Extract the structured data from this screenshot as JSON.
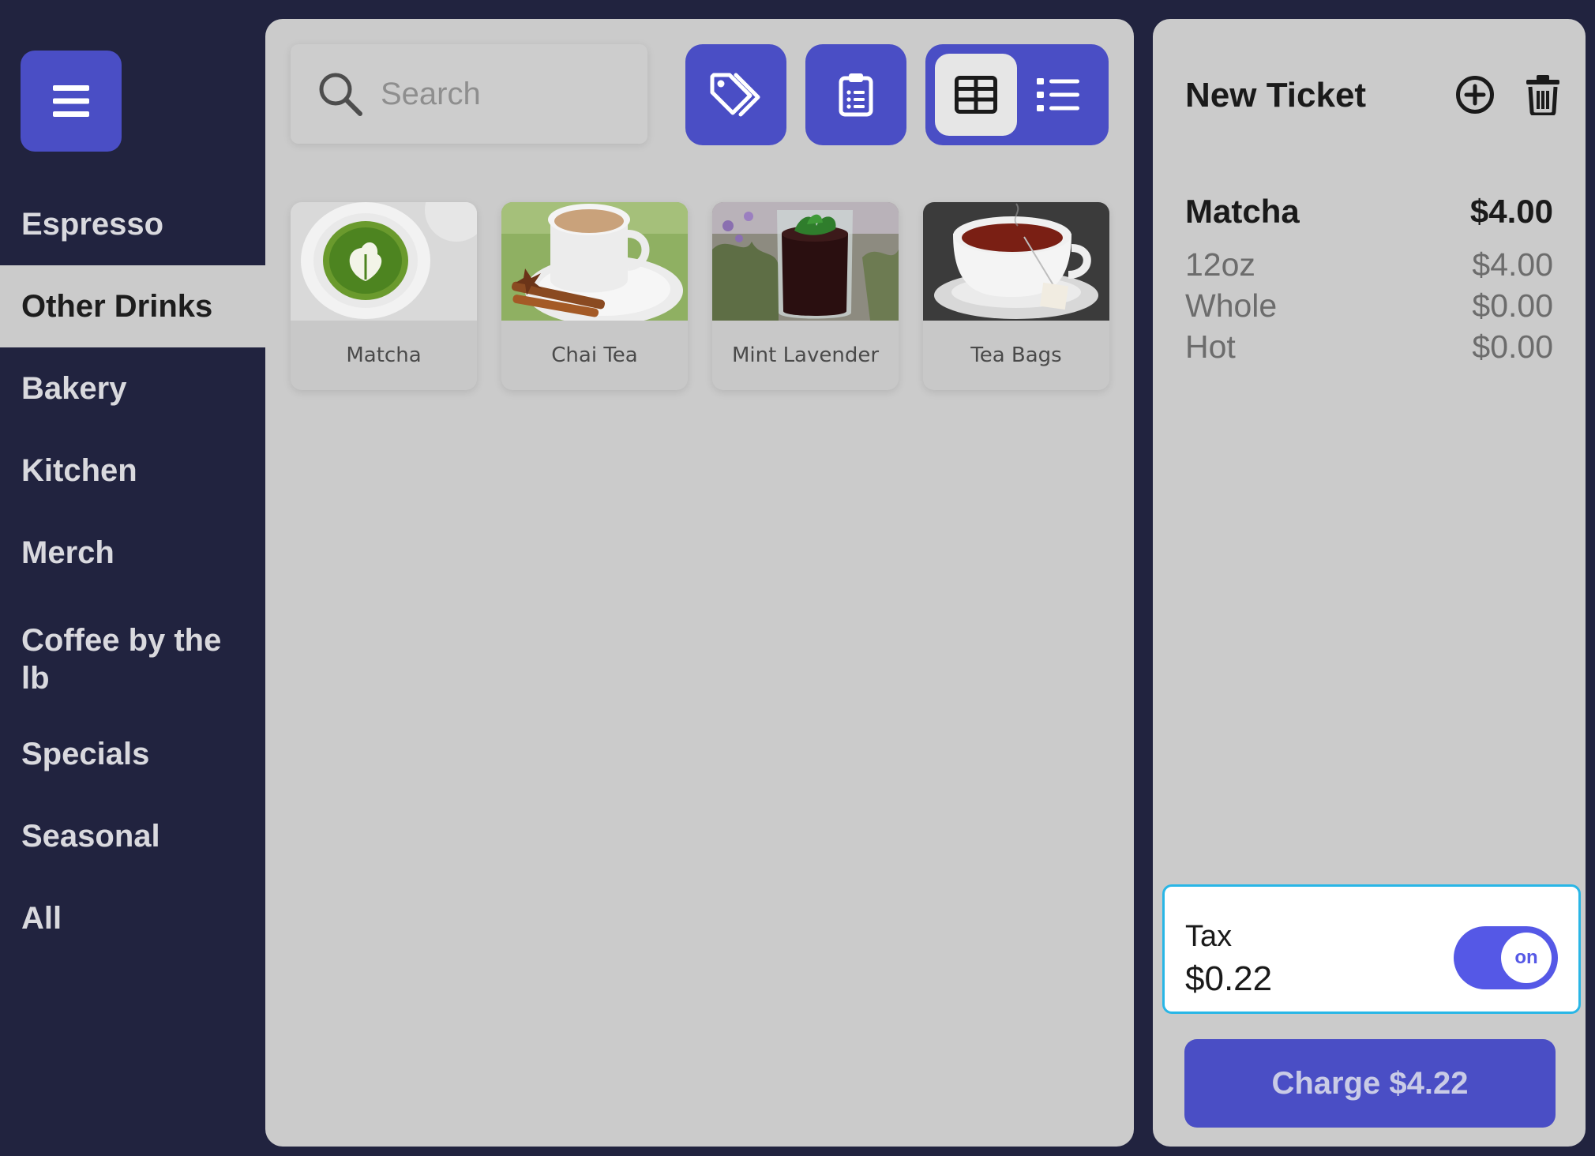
{
  "colors": {
    "sidebar_bg": "#21233f",
    "panel_bg": "#cbcbcb",
    "accent": "#4a4ec5",
    "toggle_on": "#5558e6",
    "focus_outline": "#29b6e6"
  },
  "sidebar": {
    "menu_icon": "hamburger-icon",
    "items": [
      {
        "label": "Espresso"
      },
      {
        "label": "Other Drinks",
        "active": true
      },
      {
        "label": "Bakery"
      },
      {
        "label": "Kitchen"
      },
      {
        "label": "Merch"
      },
      {
        "label": "Coffee by the lb"
      },
      {
        "label": "Specials"
      },
      {
        "label": "Seasonal"
      },
      {
        "label": "All"
      }
    ]
  },
  "toolbar": {
    "search_placeholder": "Search",
    "search_icon": "search-icon",
    "discount_icon": "tags-icon",
    "orders_icon": "clipboard-list-icon",
    "view_modes": [
      {
        "icon": "grid-icon",
        "selected": true
      },
      {
        "icon": "list-icon",
        "selected": false
      }
    ]
  },
  "products": [
    {
      "name": "Matcha"
    },
    {
      "name": "Chai Tea"
    },
    {
      "name": "Mint Lavender"
    },
    {
      "name": "Tea Bags"
    }
  ],
  "ticket": {
    "title": "New Ticket",
    "add_icon": "plus-circle-icon",
    "delete_icon": "trash-icon",
    "line": {
      "name": "Matcha",
      "price": "$4.00",
      "modifiers": [
        {
          "name": "12oz",
          "price": "$4.00"
        },
        {
          "name": "Whole",
          "price": "$0.00"
        },
        {
          "name": "Hot",
          "price": "$0.00"
        }
      ]
    },
    "tax": {
      "label": "Tax",
      "amount": "$0.22",
      "toggle_label": "on"
    },
    "charge_label": "Charge $4.22"
  }
}
